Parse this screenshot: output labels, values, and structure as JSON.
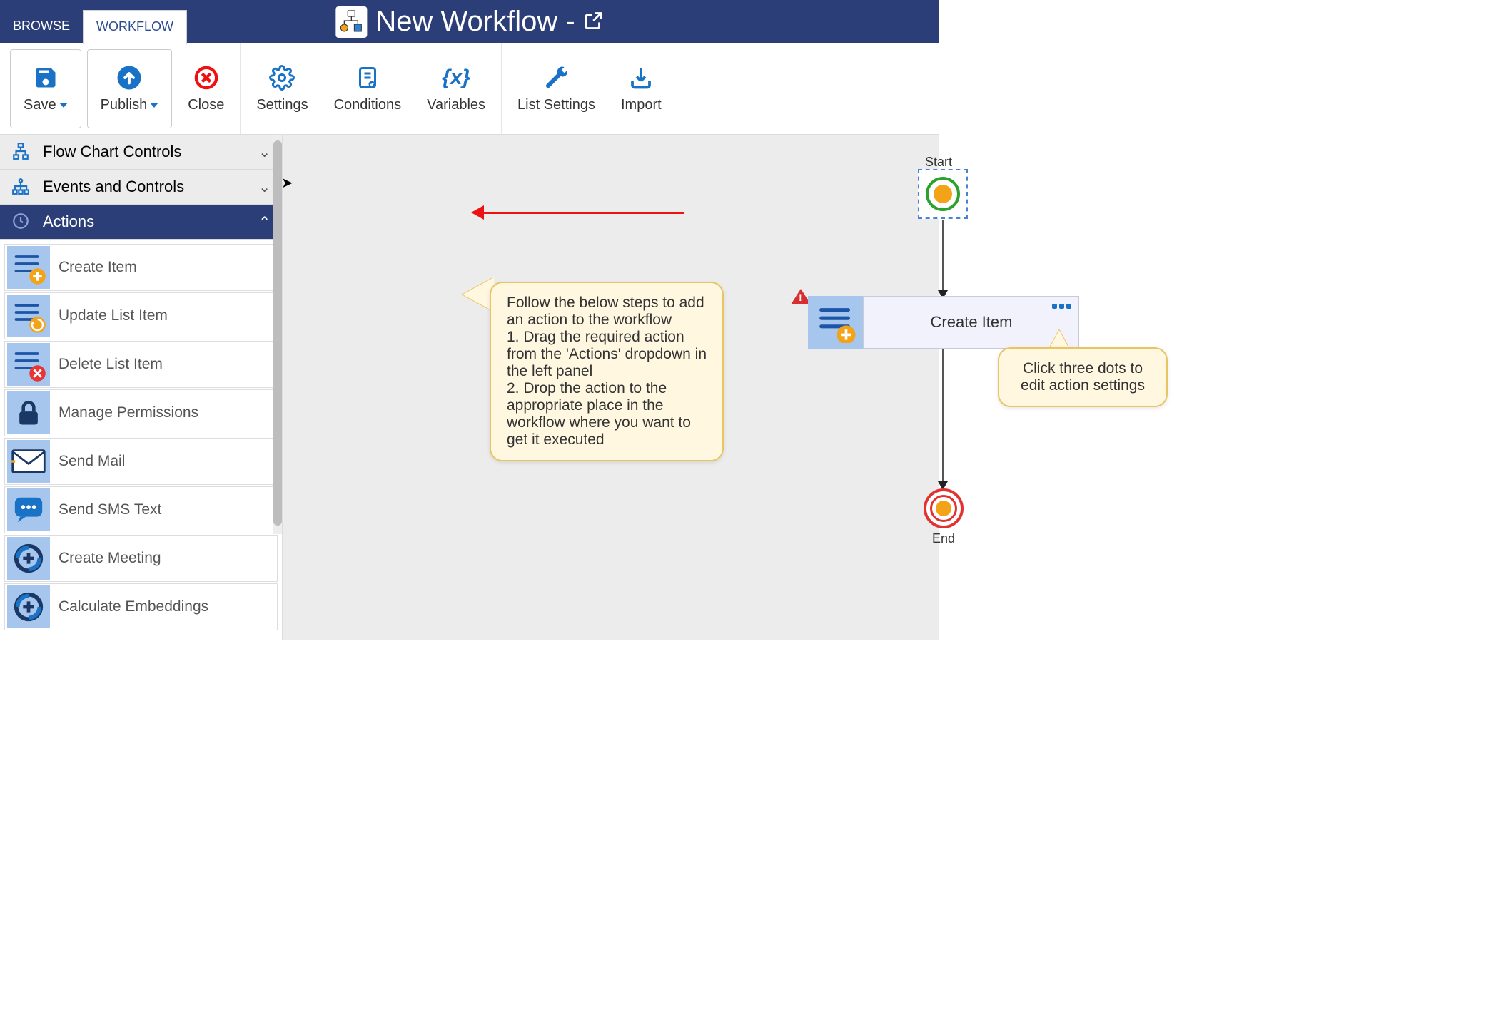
{
  "header": {
    "tabs": {
      "browse": "BROWSE",
      "workflow": "WORKFLOW"
    },
    "title": "New Workflow -"
  },
  "ribbon": {
    "save": "Save",
    "publish": "Publish",
    "close": "Close",
    "settings": "Settings",
    "conditions": "Conditions",
    "variables": "Variables",
    "list_settings": "List Settings",
    "import": "Import"
  },
  "sidebar": {
    "sections": {
      "flow_chart": "Flow Chart Controls",
      "events": "Events and Controls",
      "actions": "Actions"
    },
    "actions": [
      "Create Item",
      "Update List Item",
      "Delete List Item",
      "Manage Permissions",
      "Send Mail",
      "Send SMS Text",
      "Create Meeting",
      "Calculate Embeddings"
    ]
  },
  "canvas": {
    "start_label": "Start",
    "end_label": "End",
    "action_node_label": "Create Item"
  },
  "callouts": {
    "instructions": "Follow the below steps to add an action to the workflow\n1. Drag the required action from the 'Actions' dropdown in the left panel\n2. Drop the action to the appropriate place in the workflow where you want to get it executed",
    "dots_hint": "Click three dots to edit action settings"
  }
}
